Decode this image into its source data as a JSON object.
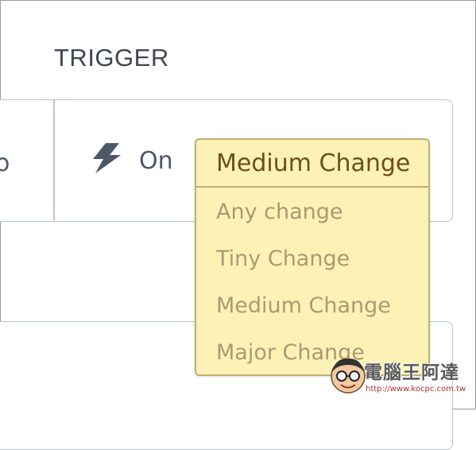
{
  "section": {
    "title": "TRIGGER"
  },
  "trigger": {
    "cut_off_text": "o",
    "icon": "lightning-bolt-icon",
    "on_label": "On"
  },
  "dropdown": {
    "selected": "Medium Change",
    "options": [
      "Any change",
      "Tiny Change",
      "Medium Change",
      "Major Change"
    ]
  },
  "watermark": {
    "logo_text": "電腦王阿達",
    "url": "http://www.kocpc.com.tw"
  },
  "colors": {
    "title_text": "#3f4753",
    "card_border": "#b9c3cf",
    "label_text": "#4c5867",
    "dropdown_bg": "#fdf2b6",
    "dropdown_border": "#c3ad70",
    "selected_text": "#6d4f16",
    "option_text": "#aa9a72"
  }
}
